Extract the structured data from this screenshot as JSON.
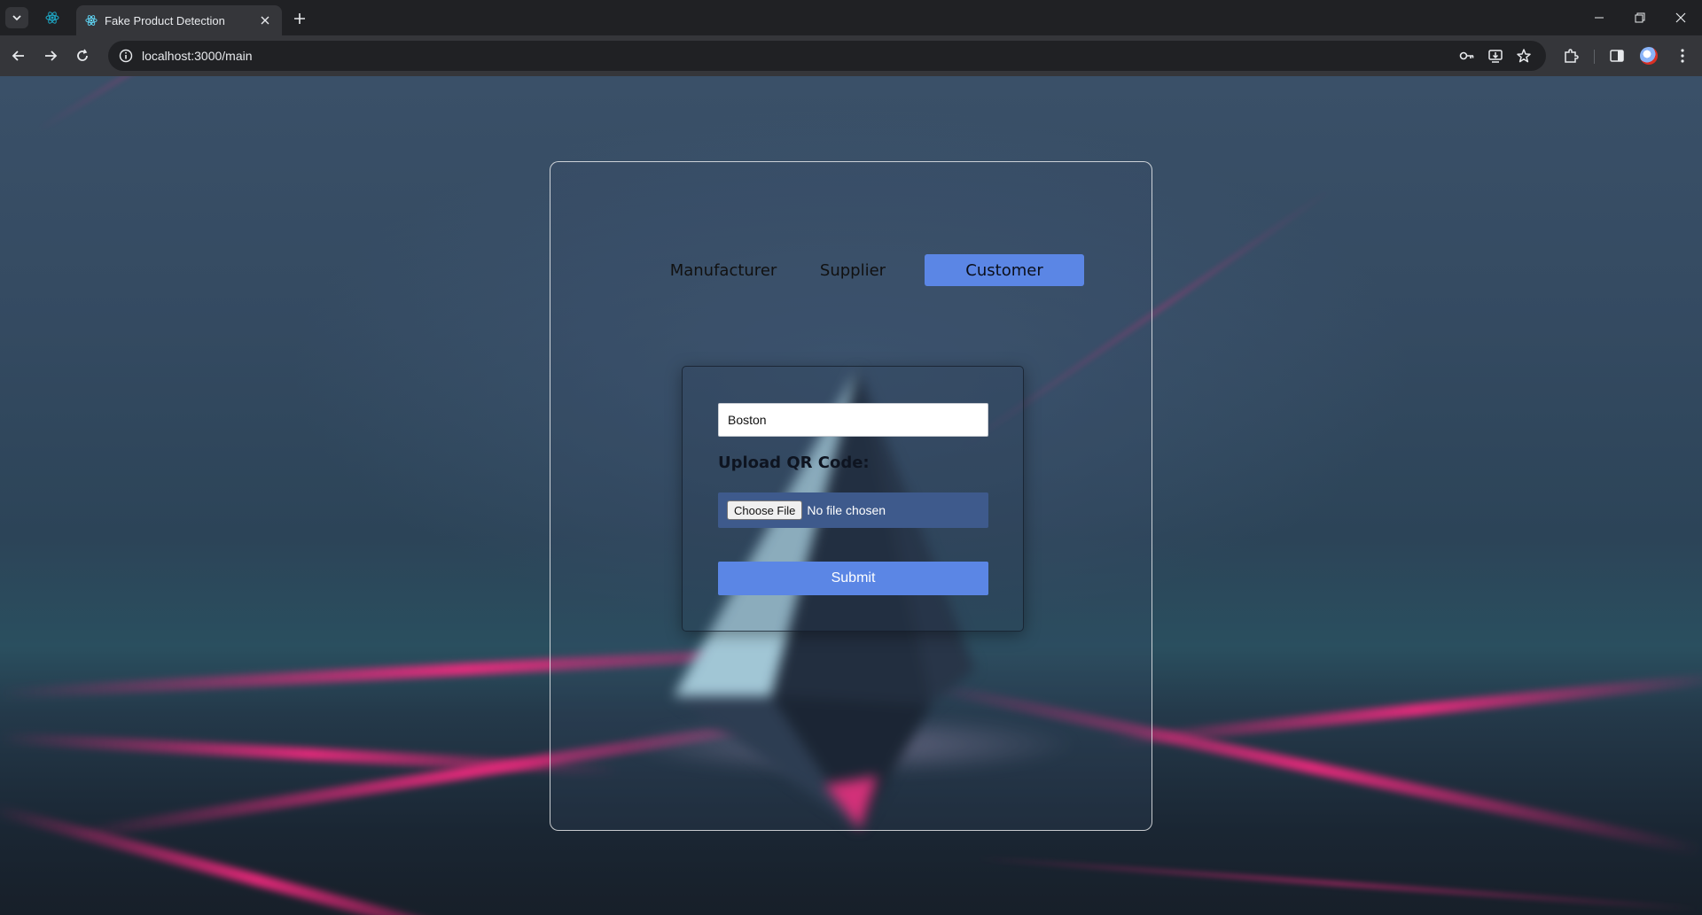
{
  "browser": {
    "tab_title": "Fake Product Detection",
    "url": "localhost:3000/main"
  },
  "colors": {
    "accent": "#5b86e5",
    "file_box": "#3e5a8c",
    "beam": "#ff2882"
  },
  "icons": [
    "tab-search-icon",
    "react-favicon-icon",
    "close-icon",
    "plus-icon",
    "back-arrow-icon",
    "forward-arrow-icon",
    "reload-icon",
    "site-info-icon",
    "password-key-icon",
    "install-app-icon",
    "bookmark-star-icon",
    "extensions-icon",
    "side-panel-icon",
    "profile-avatar",
    "more-menu-icon",
    "minimize-icon",
    "restore-icon",
    "window-close-icon"
  ],
  "roles": {
    "items": [
      {
        "label": "Manufacturer",
        "active": false
      },
      {
        "label": "Supplier",
        "active": false
      },
      {
        "label": "Customer",
        "active": true
      }
    ]
  },
  "form": {
    "location_value": "Boston",
    "upload_label": "Upload QR Code:",
    "choose_file_label": "Choose File",
    "file_status": "No file chosen",
    "submit_label": "Submit"
  }
}
